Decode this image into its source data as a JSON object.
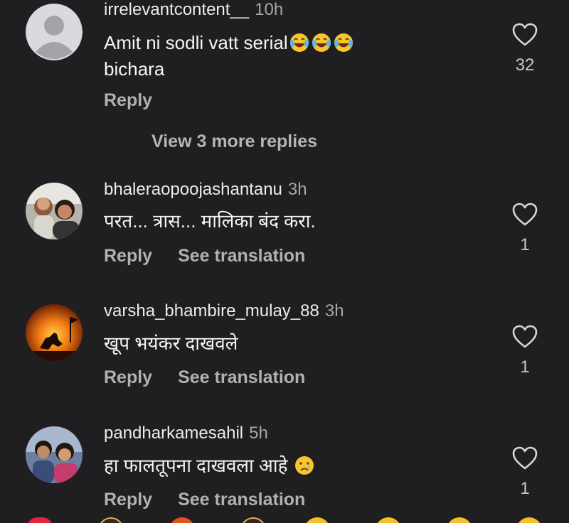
{
  "comments": [
    {
      "username": "irrelevantcontent__",
      "time": "10h",
      "text": "Amit ni sodli vatt serial",
      "text_suffix": "bichara",
      "emoji": [
        "tears-of-joy-emoji",
        "tears-of-joy-emoji",
        "tears-of-joy-emoji"
      ],
      "reply_label": "Reply",
      "like_count": "32"
    },
    {
      "username": "bhaleraopoojashantanu",
      "time": "3h",
      "text": "परत... त्रास... मालिका बंद करा.",
      "reply_label": "Reply",
      "translation_label": "See translation",
      "like_count": "1"
    },
    {
      "username": "varsha_bhambire_mulay_88",
      "time": "3h",
      "text": "खूप भयंकर दाखवले",
      "reply_label": "Reply",
      "translation_label": "See translation",
      "like_count": "1"
    },
    {
      "username": "pandharkamesahil",
      "time": "5h",
      "text": "हा फालतूपना दाखवला आहे",
      "emoji": [
        "crying-face-emoji"
      ],
      "reply_label": "Reply",
      "translation_label": "See translation",
      "like_count": "1"
    }
  ],
  "view_more_replies": "View 3 more replies",
  "colors": {
    "background": "#1f1f21",
    "username": "#ececec",
    "secondary_text": "#a7a7aa",
    "action_text": "#b1b1b4",
    "heart_outline": "#d6d6d9"
  },
  "reaction_bar": [
    "red-heart-emoji",
    "raising-hands-emoji",
    "fire-emoji",
    "clapping-emoji",
    "crying-face-emoji",
    "heart-eyes-emoji",
    "laughing-emoji",
    "surprised-face-emoji"
  ]
}
